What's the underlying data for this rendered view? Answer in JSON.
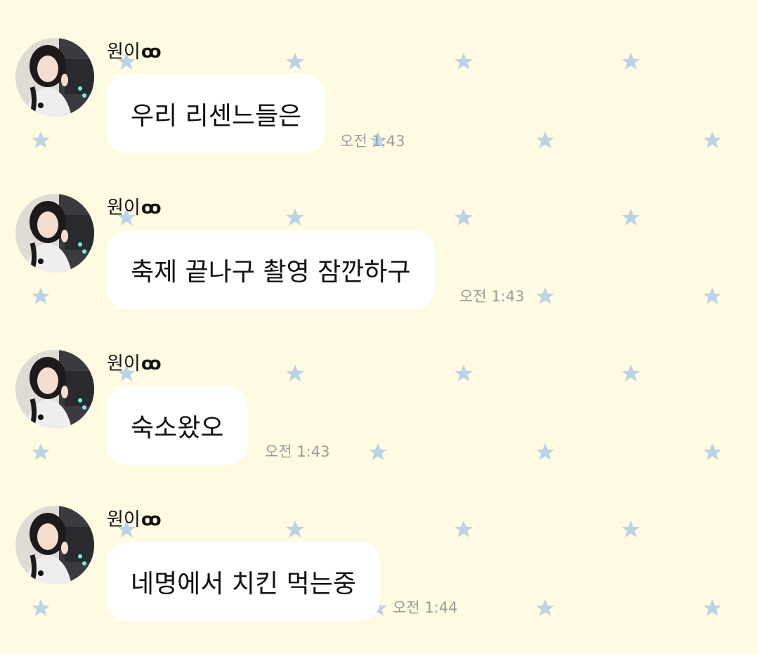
{
  "chat": {
    "background_color": "#fffbe3",
    "star_color": "#bcd3e6",
    "messages": [
      {
        "sender": "원이",
        "sender_deco": "ꝏ",
        "text": "우리 리센느들은",
        "time": "오전 1:43"
      },
      {
        "sender": "원이",
        "sender_deco": "ꝏ",
        "text": "축제 끝나구 촬영 잠깐하구",
        "time": "오전 1:43"
      },
      {
        "sender": "원이",
        "sender_deco": "ꝏ",
        "text": "숙소왔오",
        "time": "오전 1:43"
      },
      {
        "sender": "원이",
        "sender_deco": "ꝏ",
        "text": "네명에서 치킨 먹는중",
        "time": "오전 1:44"
      }
    ]
  }
}
